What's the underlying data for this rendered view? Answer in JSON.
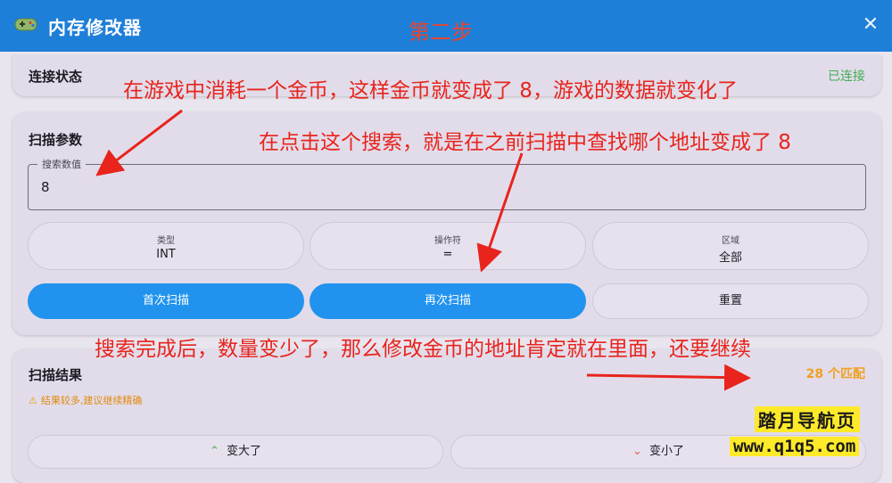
{
  "app": {
    "title": "内存修改器",
    "icon": "gamepad-icon",
    "close_icon": "close-icon"
  },
  "status": {
    "label": "连接状态",
    "value": "已连接"
  },
  "scan_params": {
    "label": "扫描参数",
    "search_field": {
      "label": "搜索数值",
      "value": "8"
    },
    "options": [
      {
        "label": "类型",
        "value": "INT"
      },
      {
        "label": "操作符",
        "value": "="
      },
      {
        "label": "区域",
        "value": "全部"
      }
    ],
    "buttons": {
      "first_scan": "首次扫描",
      "next_scan": "再次扫描",
      "reset": "重置"
    }
  },
  "scan_results": {
    "label": "扫描结果",
    "match_count": "28 个匹配",
    "warning": "结果较多,建议继续精确",
    "buttons": {
      "increased": "变大了",
      "decreased": "变小了"
    }
  },
  "annotations": {
    "step": "第二步",
    "note1": "在游戏中消耗一个金币，这样金币就变成了 8，游戏的数据就变化了",
    "note2": "在点击这个搜索，就是在之前扫描中查找哪个地址变成了 8",
    "note3": "搜索完成后，数量变少了，那么修改金币的地址肯定就在里面，还要继续"
  },
  "watermark": {
    "name": "踏月导航页",
    "url": "www.q1q5.com"
  },
  "colors": {
    "accent": "#1e7fd8",
    "button_blue": "#2193ee",
    "connected": "#3fae52",
    "warning": "#f0a020",
    "annotation": "#e8241c"
  }
}
